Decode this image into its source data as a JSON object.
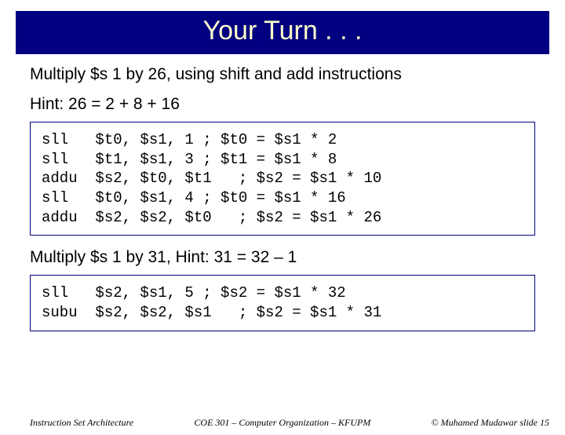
{
  "title": "Your Turn . . .",
  "line1": "Multiply $s 1 by 26, using shift and add instructions",
  "line2": "Hint: 26 = 2 + 8 + 16",
  "code1": "sll   $t0, $s1, 1 ; $t0 = $s1 * 2\nsll   $t1, $s1, 3 ; $t1 = $s1 * 8\naddu  $s2, $t0, $t1   ; $s2 = $s1 * 10\nsll   $t0, $s1, 4 ; $t0 = $s1 * 16\naddu  $s2, $s2, $t0   ; $s2 = $s1 * 26",
  "line3": "Multiply $s 1 by 31, Hint: 31 = 32 – 1",
  "code2": "sll   $s2, $s1, 5 ; $s2 = $s1 * 32\nsubu  $s2, $s2, $s1   ; $s2 = $s1 * 31",
  "footer": {
    "left": "Instruction Set Architecture",
    "center": "COE 301 – Computer Organization – KFUPM",
    "right": "© Muhamed Mudawar   slide 15"
  }
}
